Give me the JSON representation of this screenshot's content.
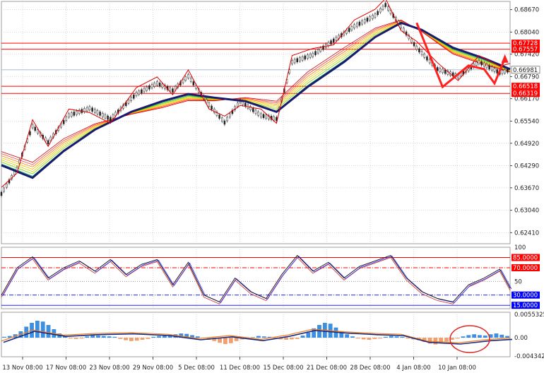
{
  "chart_data": {
    "type": "line",
    "title": "",
    "x_ticks": [
      "13 Nov 08:00",
      "17 Nov 08:00",
      "23 Nov 08:00",
      "29 Nov 08:00",
      "5 Dec 08:00",
      "11 Dec 08:00",
      "15 Dec 08:00",
      "21 Dec 08:00",
      "28 Dec 08:00",
      "4 Jan 08:00",
      "10 Jan 08:00"
    ],
    "price_panel": {
      "ylim": [
        0.621,
        0.689
      ],
      "y_ticks": [
        "0.68670",
        "0.68040",
        "0.67420",
        "0.66790",
        "0.66170",
        "0.65540",
        "0.64920",
        "0.64290",
        "0.63670",
        "0.63040",
        "0.62410"
      ],
      "horizontal_levels": [
        {
          "value": 0.67728,
          "label": "0.67728",
          "color": "#ff0000"
        },
        {
          "value": 0.67557,
          "label": "0.67557",
          "color": "#ff0000"
        },
        {
          "value": 0.66518,
          "label": "0.66518",
          "color": "#ff0000"
        },
        {
          "value": 0.66319,
          "label": "0.66319",
          "color": "#ff0000"
        }
      ],
      "current_price": {
        "value": 0.66981,
        "label": "0.66981"
      },
      "close_series": [
        {
          "t": 0,
          "v": 0.635
        },
        {
          "t": 3,
          "v": 0.642
        },
        {
          "t": 6,
          "v": 0.654
        },
        {
          "t": 9,
          "v": 0.6495
        },
        {
          "t": 13,
          "v": 0.657
        },
        {
          "t": 17,
          "v": 0.659
        },
        {
          "t": 21,
          "v": 0.656
        },
        {
          "t": 26,
          "v": 0.663
        },
        {
          "t": 30,
          "v": 0.666
        },
        {
          "t": 33,
          "v": 0.664
        },
        {
          "t": 36,
          "v": 0.668
        },
        {
          "t": 40,
          "v": 0.66
        },
        {
          "t": 43,
          "v": 0.655
        },
        {
          "t": 46,
          "v": 0.661
        },
        {
          "t": 50,
          "v": 0.657
        },
        {
          "t": 53,
          "v": 0.656
        },
        {
          "t": 56,
          "v": 0.672
        },
        {
          "t": 60,
          "v": 0.674
        },
        {
          "t": 64,
          "v": 0.678
        },
        {
          "t": 68,
          "v": 0.682
        },
        {
          "t": 72,
          "v": 0.685
        },
        {
          "t": 74,
          "v": 0.688
        },
        {
          "t": 77,
          "v": 0.682
        },
        {
          "t": 80,
          "v": 0.676
        },
        {
          "t": 84,
          "v": 0.67
        },
        {
          "t": 88,
          "v": 0.668
        },
        {
          "t": 92,
          "v": 0.672
        },
        {
          "t": 96,
          "v": 0.669
        },
        {
          "t": 98,
          "v": 0.6698
        }
      ],
      "ma_series": [
        {
          "t": 0,
          "v": 0.643
        },
        {
          "t": 6,
          "v": 0.6395
        },
        {
          "t": 12,
          "v": 0.647
        },
        {
          "t": 18,
          "v": 0.653
        },
        {
          "t": 25,
          "v": 0.658
        },
        {
          "t": 31,
          "v": 0.661
        },
        {
          "t": 36,
          "v": 0.663
        },
        {
          "t": 41,
          "v": 0.662
        },
        {
          "t": 47,
          "v": 0.661
        },
        {
          "t": 53,
          "v": 0.658
        },
        {
          "t": 59,
          "v": 0.665
        },
        {
          "t": 66,
          "v": 0.672
        },
        {
          "t": 72,
          "v": 0.679
        },
        {
          "t": 77,
          "v": 0.683
        },
        {
          "t": 81,
          "v": 0.681
        },
        {
          "t": 87,
          "v": 0.676
        },
        {
          "t": 93,
          "v": 0.673
        },
        {
          "t": 98,
          "v": 0.67
        }
      ]
    },
    "oscillator_panel": {
      "ylim": [
        10,
        100
      ],
      "y_ticks": [
        "100"
      ],
      "levels": [
        {
          "value": 85,
          "label": "85.0000",
          "color": "#ff0000",
          "style": "solid"
        },
        {
          "value": 70,
          "label": "70.0000",
          "color": "#ff0000",
          "style": "dashdot"
        },
        {
          "value": 50,
          "label": "50",
          "color": "#888888",
          "style": "dotted"
        },
        {
          "value": 30,
          "label": "30.0000",
          "color": "#0000ff",
          "style": "dashdot"
        },
        {
          "value": 15,
          "label": "15.0000",
          "color": "#0000ff",
          "style": "solid"
        }
      ],
      "series": [
        {
          "t": 0,
          "v": 30
        },
        {
          "t": 3,
          "v": 70
        },
        {
          "t": 6,
          "v": 86
        },
        {
          "t": 9,
          "v": 55
        },
        {
          "t": 12,
          "v": 70
        },
        {
          "t": 15,
          "v": 80
        },
        {
          "t": 18,
          "v": 65
        },
        {
          "t": 21,
          "v": 82
        },
        {
          "t": 24,
          "v": 60
        },
        {
          "t": 27,
          "v": 75
        },
        {
          "t": 30,
          "v": 82
        },
        {
          "t": 33,
          "v": 45
        },
        {
          "t": 36,
          "v": 78
        },
        {
          "t": 39,
          "v": 30
        },
        {
          "t": 42,
          "v": 20
        },
        {
          "t": 45,
          "v": 55
        },
        {
          "t": 48,
          "v": 35
        },
        {
          "t": 51,
          "v": 25
        },
        {
          "t": 54,
          "v": 60
        },
        {
          "t": 57,
          "v": 88
        },
        {
          "t": 60,
          "v": 65
        },
        {
          "t": 63,
          "v": 78
        },
        {
          "t": 66,
          "v": 55
        },
        {
          "t": 69,
          "v": 72
        },
        {
          "t": 72,
          "v": 80
        },
        {
          "t": 75,
          "v": 88
        },
        {
          "t": 78,
          "v": 55
        },
        {
          "t": 81,
          "v": 35
        },
        {
          "t": 84,
          "v": 25
        },
        {
          "t": 87,
          "v": 20
        },
        {
          "t": 90,
          "v": 45
        },
        {
          "t": 93,
          "v": 55
        },
        {
          "t": 96,
          "v": 68
        },
        {
          "t": 98,
          "v": 40
        }
      ]
    },
    "histogram_panel": {
      "ylim": [
        -0.0045,
        0.006
      ],
      "y_ticks": [
        "0.0055325",
        "0.00",
        "-0.004342"
      ],
      "bars": [
        2,
        4,
        8,
        15,
        26,
        35,
        40,
        38,
        30,
        20,
        10,
        4,
        -2,
        -3,
        -2,
        3,
        6,
        5,
        4,
        3,
        2,
        -3,
        -6,
        -8,
        -7,
        -5,
        -3,
        2,
        4,
        5,
        6,
        8,
        10,
        9,
        6,
        3,
        -2,
        -5,
        -8,
        -12,
        -15,
        -13,
        -8,
        -4,
        -2,
        1,
        4,
        3,
        2,
        -2,
        -4,
        -5,
        -4,
        -3,
        5,
        12,
        22,
        30,
        35,
        33,
        24,
        15,
        8,
        3,
        -2,
        -4,
        -5,
        -3,
        -2,
        2,
        4,
        3,
        2,
        -2,
        -4,
        -6,
        -10,
        -14,
        -16,
        -13,
        -9,
        -5,
        -2,
        3,
        6,
        8,
        6,
        5,
        8,
        10,
        7,
        4
      ],
      "signal": [
        {
          "t": 0,
          "v": -0.0008
        },
        {
          "t": 6,
          "v": 0.0018
        },
        {
          "t": 12,
          "v": 0.0006
        },
        {
          "t": 18,
          "v": 0.001
        },
        {
          "t": 25,
          "v": 0.0012
        },
        {
          "t": 32,
          "v": 0.0008
        },
        {
          "t": 38,
          "v": -0.0002
        },
        {
          "t": 44,
          "v": 0.0005
        },
        {
          "t": 50,
          "v": -0.0004
        },
        {
          "t": 55,
          "v": 0.0006
        },
        {
          "t": 60,
          "v": 0.002
        },
        {
          "t": 66,
          "v": 0.0014
        },
        {
          "t": 72,
          "v": 0.001
        },
        {
          "t": 77,
          "v": 0.0008
        },
        {
          "t": 82,
          "v": -0.0008
        },
        {
          "t": 88,
          "v": -0.0012
        },
        {
          "t": 94,
          "v": -0.0004
        },
        {
          "t": 98,
          "v": -0.0001
        }
      ]
    }
  }
}
